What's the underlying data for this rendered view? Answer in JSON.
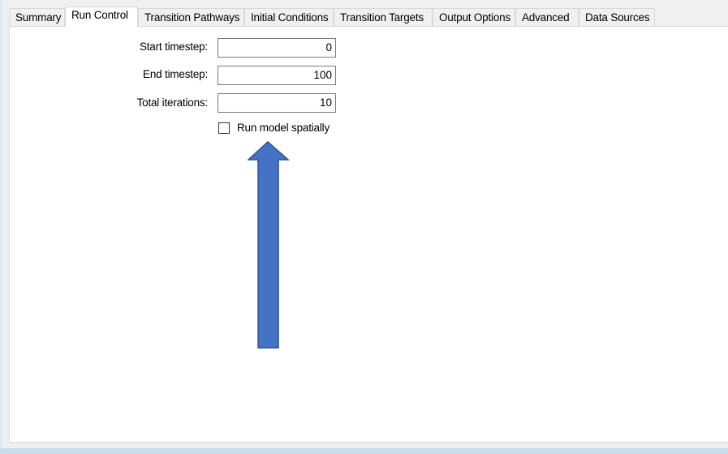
{
  "tabs": [
    {
      "label": "Summary",
      "active": false
    },
    {
      "label": "Run Control",
      "active": true
    },
    {
      "label": "Transition Pathways",
      "active": false
    },
    {
      "label": "Initial Conditions",
      "active": false
    },
    {
      "label": "Transition Targets",
      "active": false
    },
    {
      "label": "Output Options",
      "active": false
    },
    {
      "label": "Advanced",
      "active": false
    },
    {
      "label": "Data Sources",
      "active": false
    }
  ],
  "run_control": {
    "start_timestep": {
      "label": "Start timestep:",
      "value": "0"
    },
    "end_timestep": {
      "label": "End timestep:",
      "value": "100"
    },
    "total_iterations": {
      "label": "Total iterations:",
      "value": "10"
    },
    "run_spatially": {
      "label": "Run model spatially",
      "checked": false
    }
  },
  "annotation": {
    "icon": "up-arrow-icon",
    "color": "#4472c4",
    "outline": "#2f5597"
  }
}
